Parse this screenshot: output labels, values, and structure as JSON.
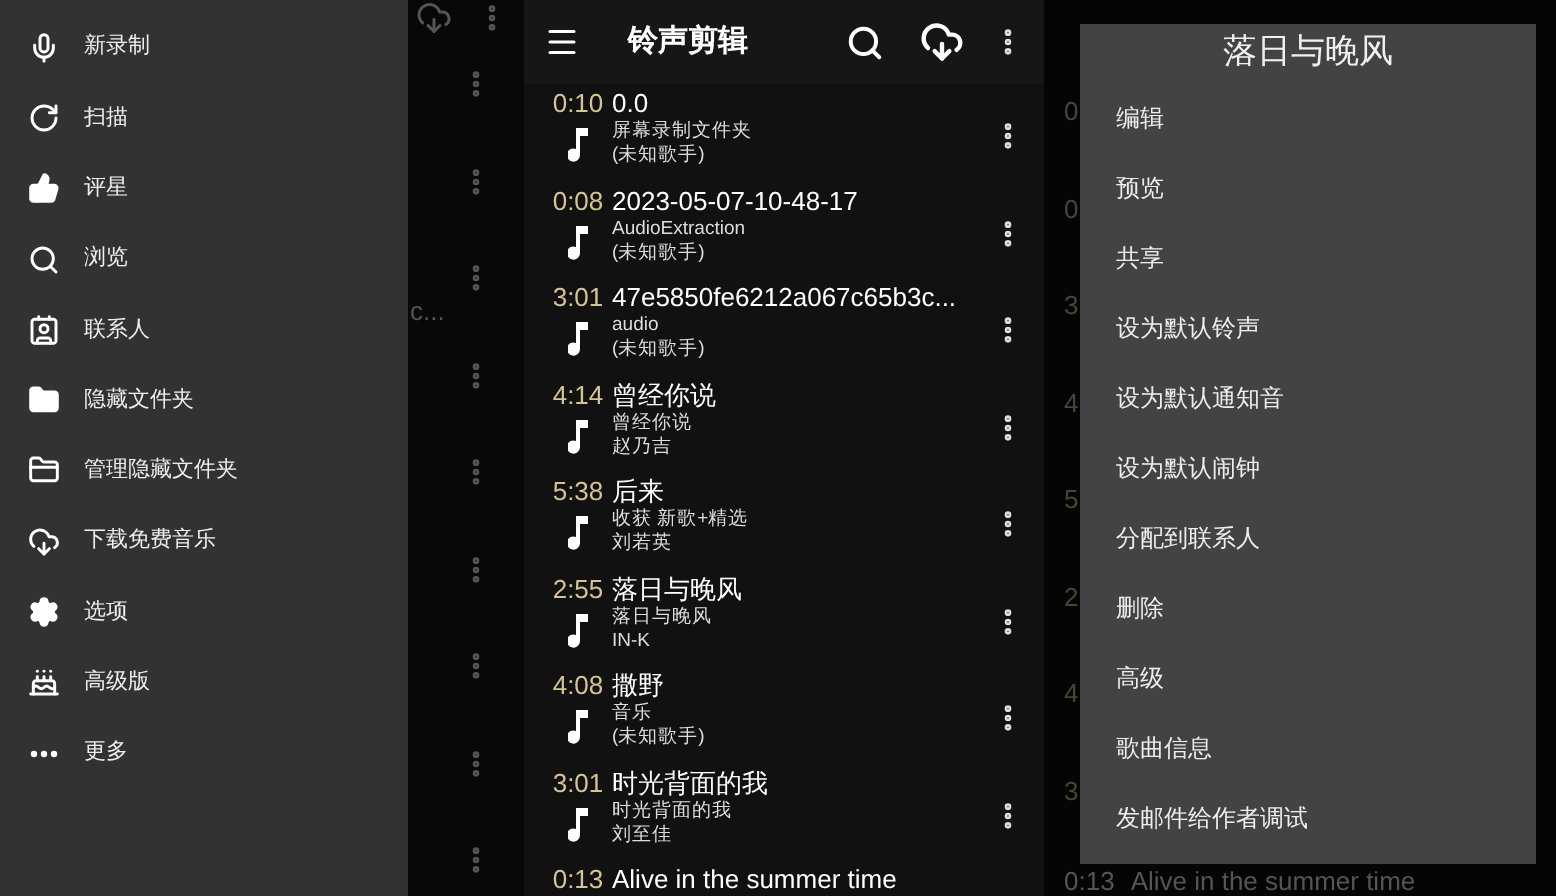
{
  "left_screen": {
    "background": {
      "fragment": "c..."
    },
    "drawer": {
      "items": [
        {
          "label": "新录制"
        },
        {
          "label": "扫描"
        },
        {
          "label": "评星"
        },
        {
          "label": "浏览"
        },
        {
          "label": "联系人"
        },
        {
          "label": "隐藏文件夹"
        },
        {
          "label": "管理隐藏文件夹"
        },
        {
          "label": "下载免费音乐"
        },
        {
          "label": "选项"
        },
        {
          "label": "高级版"
        },
        {
          "label": "更多"
        }
      ]
    }
  },
  "middle_screen": {
    "toolbar": {
      "title": "铃声剪辑"
    },
    "songs": [
      {
        "duration": "0:10",
        "title": "0.0",
        "album": "屏幕录制文件夹",
        "artist": "(未知歌手)"
      },
      {
        "duration": "0:08",
        "title": "2023-05-07-10-48-17",
        "album": "AudioExtraction",
        "artist": "(未知歌手)"
      },
      {
        "duration": "3:01",
        "title": "47e5850fe6212a067c65b3c...",
        "album": "audio",
        "artist": "(未知歌手)"
      },
      {
        "duration": "4:14",
        "title": "曾经你说",
        "album": "曾经你说",
        "artist": "赵乃吉"
      },
      {
        "duration": "5:38",
        "title": "后来",
        "album": "收获 新歌+精选",
        "artist": "刘若英"
      },
      {
        "duration": "2:55",
        "title": "落日与晚风",
        "album": "落日与晚风",
        "artist": "IN-K"
      },
      {
        "duration": "4:08",
        "title": "撒野",
        "album": "音乐",
        "artist": "(未知歌手)"
      },
      {
        "duration": "3:01",
        "title": "时光背面的我",
        "album": "时光背面的我",
        "artist": "刘至佳"
      },
      {
        "duration": "0:13",
        "title": "Alive in the summer time"
      }
    ]
  },
  "right_screen": {
    "background": {
      "time_fragments": [
        "0",
        "0",
        "3",
        "4",
        "5",
        "2",
        "4",
        "3"
      ],
      "last_row": {
        "duration": "0:13",
        "title": "Alive in the summer time"
      }
    },
    "context_menu": {
      "title": "落日与晚风",
      "items": [
        {
          "label": "编辑"
        },
        {
          "label": "预览"
        },
        {
          "label": "共享"
        },
        {
          "label": "设为默认铃声"
        },
        {
          "label": "设为默认通知音"
        },
        {
          "label": "设为默认闹钟"
        },
        {
          "label": "分配到联系人"
        },
        {
          "label": "删除"
        },
        {
          "label": "高级"
        },
        {
          "label": "歌曲信息"
        },
        {
          "label": "发邮件给作者调试"
        }
      ]
    }
  }
}
